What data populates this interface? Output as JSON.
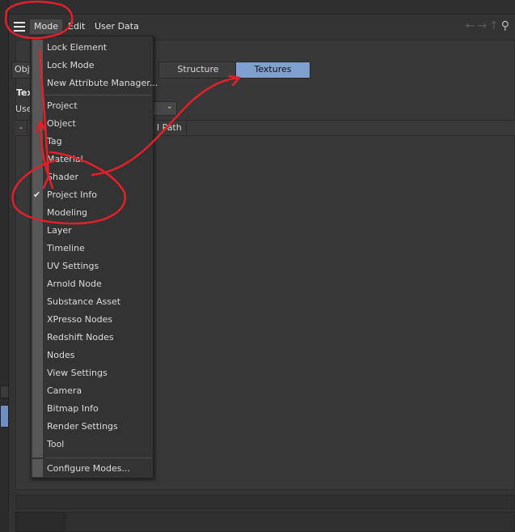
{
  "menubar": {
    "mode": "Mode",
    "edit": "Edit",
    "user_data": "User Data",
    "nav_icons": [
      "arrow-left-icon",
      "arrow-right-icon",
      "arrow-up-icon",
      "search-icon"
    ]
  },
  "panel": {
    "tab_partial": "Obj",
    "tabs": [
      {
        "label": "Structure"
      },
      {
        "label": "Textures",
        "selected": true
      }
    ],
    "section_title": "Tex",
    "row_label": "Use",
    "column_first": "-",
    "column_path": "l Path"
  },
  "dropdown": {
    "groups": [
      [
        "Lock Element",
        "Lock Mode",
        "New Attribute Manager..."
      ],
      [
        "Project",
        "Object",
        "Tag",
        "Material",
        "Shader",
        "Project Info",
        "Modeling",
        "Layer",
        "Timeline",
        "UV Settings",
        "Arnold Node",
        "Substance Asset",
        "XPresso Nodes",
        "Redshift Nodes",
        "Nodes",
        "View Settings",
        "Camera",
        "Bitmap Info",
        "Render Settings",
        "Tool"
      ],
      [
        "Configure Modes..."
      ]
    ],
    "checked": "Project Info"
  },
  "colors": {
    "accent": "#7f9fcf",
    "annotation": "#e3202a",
    "background": "#333333"
  }
}
